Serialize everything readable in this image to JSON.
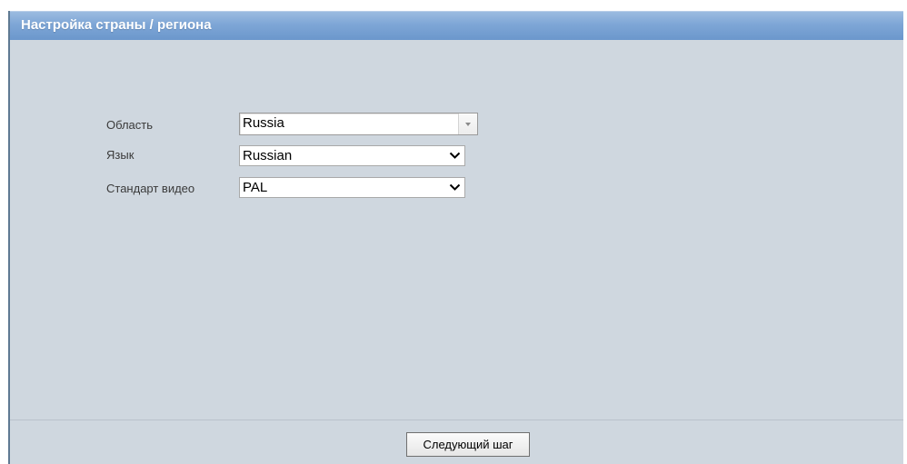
{
  "window": {
    "title": "Настройка страны / региона"
  },
  "form": {
    "region": {
      "label": "Область",
      "value": "Russia",
      "icon": "dropdown-arrow-icon"
    },
    "language": {
      "label": "Язык",
      "value": "Russian",
      "icon": "chevron-down-icon"
    },
    "video_standard": {
      "label": "Стандарт видео",
      "value": "PAL",
      "icon": "chevron-down-icon"
    }
  },
  "footer": {
    "next_button_label": "Следующий шаг"
  },
  "colors": {
    "titlebar": "#7ea6d6",
    "panel_background": "#cfd7df",
    "border_accent": "#5f7a93"
  }
}
